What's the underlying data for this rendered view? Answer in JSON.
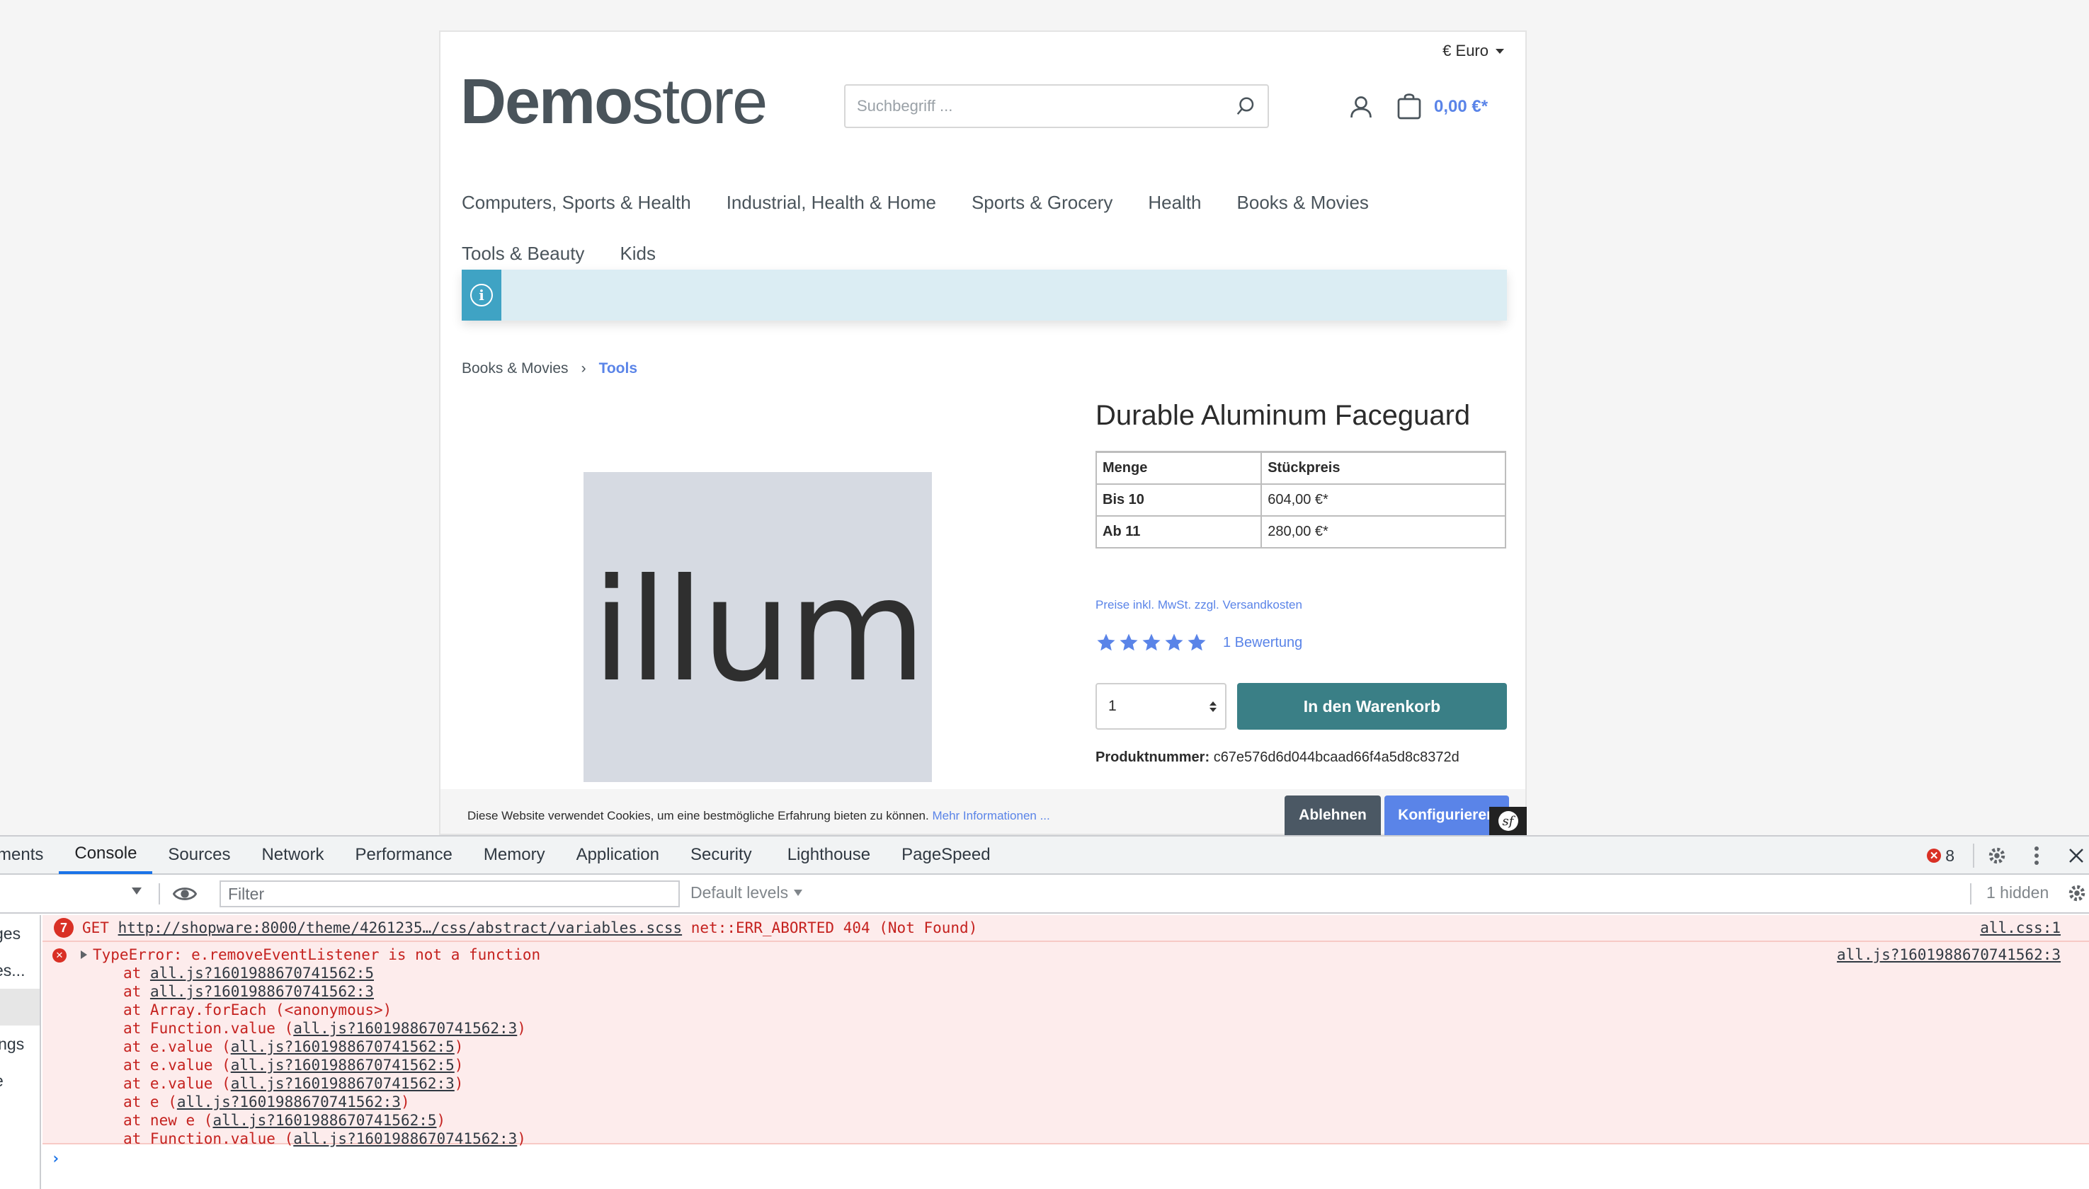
{
  "store": {
    "currency": "€ Euro",
    "logo_bold": "Demo",
    "logo_light": "store",
    "search_placeholder": "Suchbegriff ...",
    "cart_total": "0,00 €*",
    "nav_row1": [
      "Computers, Sports & Health",
      "Industrial, Health & Home",
      "Sports & Grocery",
      "Health",
      "Books & Movies"
    ],
    "nav_row2": [
      "Tools & Beauty",
      "Kids"
    ],
    "info_icon": "i",
    "breadcrumb": {
      "parent": "Books & Movies",
      "separator": "›",
      "current": "Tools"
    },
    "product_image_text": "illum",
    "product": {
      "title": "Durable Aluminum Faceguard",
      "table_headers": [
        "Menge",
        "Stückpreis"
      ],
      "table_rows": [
        {
          "qty": "Bis 10",
          "price": "604,00 €*"
        },
        {
          "qty": "Ab 11",
          "price": "280,00 €*"
        }
      ],
      "tax_note": "Preise inkl. MwSt. zzgl. Versandkosten",
      "rating_stars": 5,
      "rating_link": "1 Bewertung",
      "quantity": "1",
      "buy_label": "In den Warenkorb",
      "product_number_label": "Produktnummer:",
      "product_number": "c67e576d6d044bcaad66f4a5d8c8372d"
    },
    "cookie": {
      "text": "Diese Website verwendet Cookies, um eine bestmögliche Erfahrung bieten zu können. ",
      "link": "Mehr Informationen ...",
      "deny": "Ablehnen",
      "configure": "Konfigurieren"
    },
    "accent": "#5a84e8",
    "buy_color": "#3a7f86"
  },
  "devtools": {
    "tabs": [
      "ments",
      "Console",
      "Sources",
      "Network",
      "Performance",
      "Memory",
      "Application",
      "Security",
      "Lighthouse",
      "PageSpeed"
    ],
    "active_tab": "Console",
    "error_count": "8",
    "filter_placeholder": "Filter",
    "default_levels": "Default levels",
    "hidden": "1 hidden",
    "sidebar": [
      "ges",
      "es...",
      "",
      "ings",
      "e"
    ],
    "net_error": {
      "count": "7",
      "method": "GET",
      "url": "http://shopware:8000/theme/4261235…/css/abstract/variables.scss",
      "message": "net::ERR_ABORTED 404 (Not Found)",
      "source": "all.css:1"
    },
    "type_error": {
      "message": "TypeError: e.removeEventListener is not a function",
      "source": "all.js?1601988670741562:3",
      "stack": [
        {
          "pre": "at ",
          "link": "all.js?1601988670741562:5",
          "post": ""
        },
        {
          "pre": "at ",
          "link": "all.js?1601988670741562:3",
          "post": ""
        },
        {
          "pre": "at Array.forEach (<anonymous>)",
          "link": "",
          "post": ""
        },
        {
          "pre": "at Function.value (",
          "link": "all.js?1601988670741562:3",
          "post": ")"
        },
        {
          "pre": "at e.value (",
          "link": "all.js?1601988670741562:5",
          "post": ")"
        },
        {
          "pre": "at e.value (",
          "link": "all.js?1601988670741562:5",
          "post": ")"
        },
        {
          "pre": "at e.value (",
          "link": "all.js?1601988670741562:3",
          "post": ")"
        },
        {
          "pre": "at e (",
          "link": "all.js?1601988670741562:3",
          "post": ")"
        },
        {
          "pre": "at new e (",
          "link": "all.js?1601988670741562:5",
          "post": ")"
        },
        {
          "pre": "at Function.value (",
          "link": "all.js?1601988670741562:3",
          "post": ")"
        }
      ]
    },
    "prompt": "›"
  }
}
